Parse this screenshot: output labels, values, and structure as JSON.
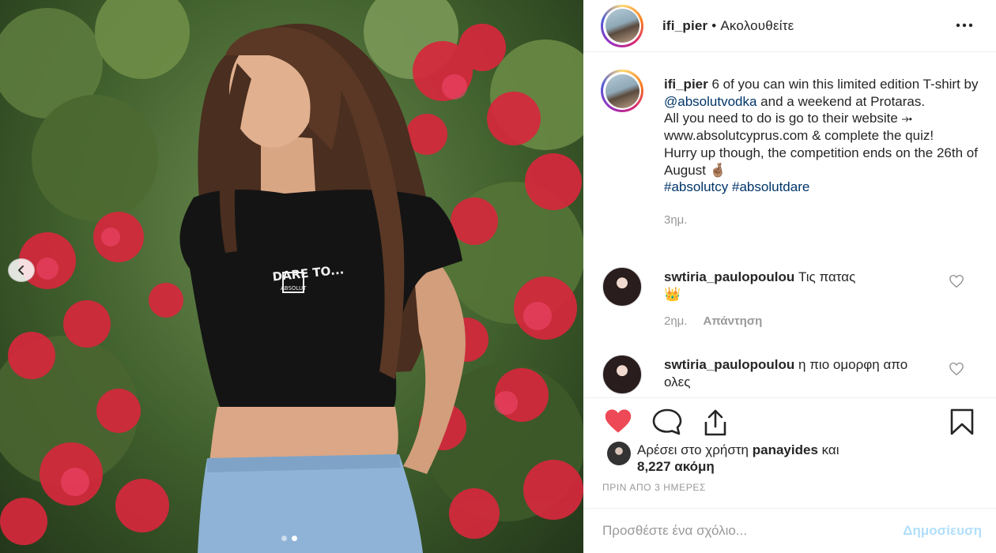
{
  "colors": {
    "like_red": "#ed4956",
    "link_blue": "#003569",
    "muted": "#999999",
    "post_blue_disabled": "#b2dffc"
  },
  "post": {
    "header": {
      "username": "ifi_pier",
      "separator": " • ",
      "follow_label": "Ακολουθείτε"
    },
    "caption": {
      "username": "ifi_pier",
      "part1": " 6 of you can win this limited edition T-shirt by ",
      "mention": "@absolutvodka",
      "part2": " and a weekend at Protaras.",
      "line2": "All you need to do is go to their website ⤞ www.absolutcyprus.com & complete the quiz!",
      "line3": "Hurry up though, the competition ends on the 26th of August 🤞🏽",
      "hashtag1": "#absolutcy",
      "hashtag2": "#absolutdare",
      "time": "3ημ."
    },
    "comments": [
      {
        "username": "swtiria_paulopoulou",
        "text": " Τις πατας",
        "emoji": "👑",
        "time": "2ημ.",
        "reply_label": "Απάντηση"
      },
      {
        "username": "swtiria_paulopoulou",
        "text": " η πιο ομορφη απο ολες"
      }
    ],
    "likes": {
      "prefix": "Αρέσει στο χρήστη ",
      "liker": "panayides",
      "suffix": " και ",
      "count": "8,227 ακόμη"
    },
    "timeago": "ΠΡΙΝ ΑΠΟ 3 ΗΜΕΡΕΣ",
    "add_comment": {
      "placeholder": "Προσθέστε ένα σχόλιο...",
      "post_label": "Δημοσίευση"
    },
    "photo": {
      "shirt_text": "DARE TO...",
      "shirt_brand": "ABSOLUT"
    },
    "icons": [
      "more-icon",
      "heart-filled-icon",
      "comment-icon",
      "share-icon",
      "bookmark-icon",
      "heart-outline-icon",
      "chevron-left-icon"
    ]
  }
}
